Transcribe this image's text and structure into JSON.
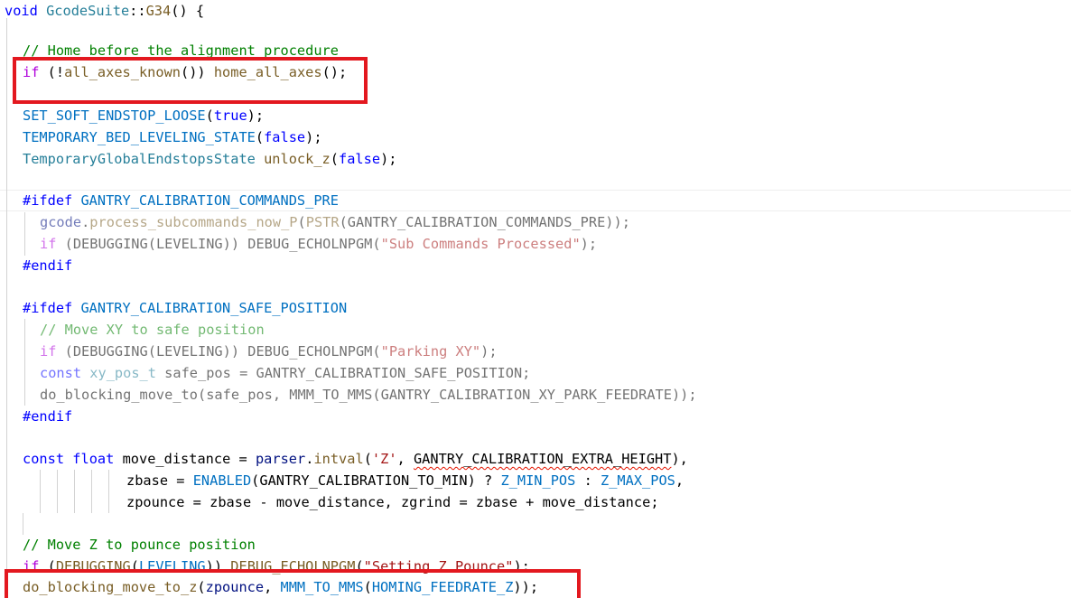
{
  "accent_colors": {
    "highlight_box": "#e3181f",
    "keyword": "#0000ff",
    "function": "#795e26",
    "macro": "#0070c1",
    "type": "#267f99",
    "comment": "#008000",
    "string": "#a31515"
  },
  "code": {
    "l1": {
      "a": "void ",
      "b": "GcodeSuite",
      "c": "::",
      "d": "G34",
      "e": "() {"
    },
    "l2": {
      "a": "// Home before the alignment procedure"
    },
    "l3": {
      "a": "if",
      "b": " (!",
      "c": "all_axes_known",
      "d": "()) ",
      "e": "home_all_axes",
      "f": "();"
    },
    "l4": {
      "a": "SET_SOFT_ENDSTOP_LOOSE",
      "b": "(",
      "c": "true",
      "d": ");"
    },
    "l5": {
      "a": "TEMPORARY_BED_LEVELING_STATE",
      "b": "(",
      "c": "false",
      "d": ");"
    },
    "l6": {
      "a": "TemporaryGlobalEndstopsState",
      "b": " ",
      "c": "unlock_z",
      "d": "(",
      "e": "false",
      "f": ");"
    },
    "l7": {
      "a": "#ifdef ",
      "b": "GANTRY_CALIBRATION_COMMANDS_PRE"
    },
    "l8": {
      "a": "gcode",
      "b": ".",
      "c": "process_subcommands_now_P",
      "d": "(",
      "e": "PSTR",
      "f": "(GANTRY_CALIBRATION_COMMANDS_PRE));"
    },
    "l9": {
      "a": "if",
      "b": " (",
      "c": "DEBUGGING",
      "d": "(LEVELING)) ",
      "e": "DEBUG_ECHOLNPGM",
      "f": "(",
      "g": "\"Sub Commands Processed\"",
      "h": ");"
    },
    "l10": {
      "a": "#endif"
    },
    "l11": {
      "a": "#ifdef ",
      "b": "GANTRY_CALIBRATION_SAFE_POSITION"
    },
    "l12": {
      "a": "// Move XY to safe position"
    },
    "l13": {
      "a": "if",
      "b": " (",
      "c": "DEBUGGING",
      "d": "(LEVELING)) ",
      "e": "DEBUG_ECHOLNPGM",
      "f": "(",
      "g": "\"Parking XY\"",
      "h": ");"
    },
    "l14": {
      "a": "const",
      "b": " ",
      "c": "xy_pos_t",
      "d": " safe_pos = GANTRY_CALIBRATION_SAFE_POSITION;"
    },
    "l15": {
      "a": "do_blocking_move_to",
      "b": "(safe_pos, ",
      "c": "MMM_TO_MMS",
      "d": "(GANTRY_CALIBRATION_XY_PARK_FEEDRATE));"
    },
    "l16": {
      "a": "#endif"
    },
    "l17": {
      "a": "const",
      "b": " ",
      "c": "float",
      "d": " ",
      "e": "move_distance",
      "f": " = ",
      "g": "parser",
      "h": ".",
      "i": "intval",
      "j": "(",
      "k": "'Z'",
      "l": ", ",
      "m": "GANTRY_CALIBRATION_EXTRA_HEIGHT",
      "n": "),"
    },
    "l18": {
      "a": "zbase",
      "b": " = ",
      "c": "ENABLED",
      "d": "(GANTRY_CALIBRATION_TO_MIN) ? ",
      "e": "Z_MIN_POS",
      "f": " : ",
      "g": "Z_MAX_POS",
      "h": ","
    },
    "l19": {
      "a": "zpounce",
      "b": " = ",
      "c": "zbase",
      "d": " - ",
      "e": "move_distance",
      "f": ", ",
      "g": "zgrind",
      "h": " = ",
      "i": "zbase",
      "j": " + ",
      "k": "move_distance",
      "l": ";"
    },
    "l20": {
      "a": "// Move Z to pounce position"
    },
    "l21": {
      "a": "if",
      "b": " (",
      "c": "DEBUGGING",
      "d": "(",
      "e": "LEVELING",
      "f": ")) ",
      "g": "DEBUG_ECHOLNPGM",
      "h": "(",
      "i": "\"Setting Z Pounce\"",
      "j": ");"
    },
    "l22": {
      "a": "do_blocking_move_to_z",
      "b": "(",
      "c": "zpounce",
      "d": ", ",
      "e": "MMM_TO_MMS",
      "f": "(",
      "g": "HOMING_FEEDRATE_Z",
      "h": "));"
    }
  }
}
